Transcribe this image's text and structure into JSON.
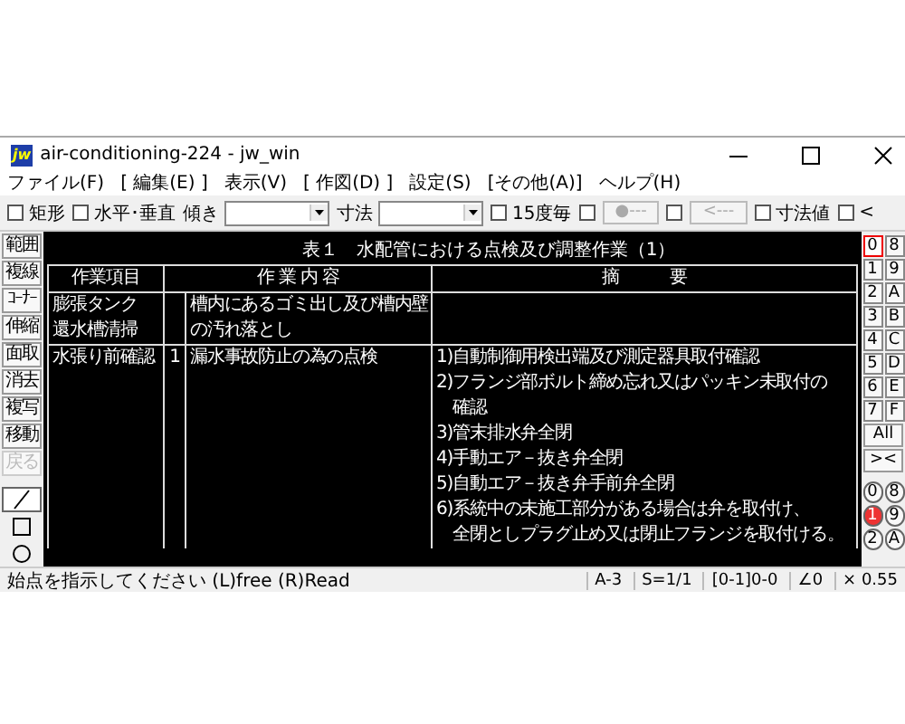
{
  "window": {
    "title": "air-conditioning-224 - jw_win",
    "app_icon_label": "jw"
  },
  "menu": [
    "ファイル(F)",
    "[ 編集(E) ]",
    "表示(V)",
    "[ 作図(D) ]",
    "設定(S)",
    "[その他(A)]",
    "ヘルプ(H)"
  ],
  "toolbar": [
    {
      "kind": "checkbox",
      "label": "矩形",
      "checked": false
    },
    {
      "kind": "checkbox",
      "label": "水平･垂直",
      "checked": false
    },
    {
      "kind": "dropdown",
      "label": "傾き"
    },
    {
      "kind": "dropdown",
      "label": "寸法"
    },
    {
      "kind": "checkbox",
      "label": "15度毎",
      "checked": false
    },
    {
      "kind": "checkbox",
      "checked": false
    },
    {
      "kind": "button",
      "label": "●---",
      "disabled": true
    },
    {
      "kind": "checkbox",
      "checked": false
    },
    {
      "kind": "button",
      "label": "<---",
      "disabled": true
    },
    {
      "kind": "checkbox",
      "label": "寸法値",
      "checked": false
    },
    {
      "kind": "checkbox",
      "label": "<",
      "checked": false
    }
  ],
  "left_tools": [
    {
      "label": "範囲",
      "disabled": false
    },
    {
      "label": "複線",
      "disabled": false
    },
    {
      "label": "ｺｰﾅｰ",
      "disabled": false
    },
    {
      "label": "伸縮",
      "disabled": false
    },
    {
      "label": "面取",
      "disabled": false
    },
    {
      "label": "消去",
      "disabled": false
    },
    {
      "label": "複写",
      "disabled": false
    },
    {
      "label": "移動",
      "disabled": false
    },
    {
      "label": "戻る",
      "disabled": true
    }
  ],
  "draw_tools": [
    {
      "kind": "line",
      "selected": true
    },
    {
      "kind": "rect",
      "selected": false
    },
    {
      "kind": "circle",
      "selected": false
    }
  ],
  "table": {
    "title": "表１　水配管における点検及び調整作業（1）",
    "columns": [
      "作業項目",
      "作 業 内 容",
      "摘　　　要"
    ],
    "rows": [
      {
        "item": [
          "膨張タンク",
          "還水槽清掃"
        ],
        "no": "",
        "content": [
          "槽内にあるゴミ出し及び槽内壁",
          "の汚れ落とし"
        ],
        "notes": []
      },
      {
        "item": [
          "水張り前確認"
        ],
        "no": "1",
        "content": [
          "漏水事故防止の為の点検"
        ],
        "notes": [
          [
            "1)自動制御用検出端及び測定器具取付確認"
          ],
          [
            "2)フランジ部ボルト締め忘れ又はパッキン未取付の",
            "確認"
          ],
          [
            "3)管末排水弁全閉"
          ],
          [
            "4)手動エア－抜き弁全閉"
          ],
          [
            "5)自動エア－抜き弁手前弁全閉"
          ],
          [
            "6)系統中の未施工部分がある場合は弁を取付け、",
            "全閉としプラグ止め又は閉止フランジを取付ける。"
          ]
        ]
      }
    ]
  },
  "layers": [
    {
      "label": "0",
      "selected": true
    },
    {
      "label": "8",
      "selected": false
    },
    {
      "label": "1",
      "selected": false
    },
    {
      "label": "9",
      "selected": false
    },
    {
      "label": "2",
      "selected": false
    },
    {
      "label": "A",
      "selected": false
    },
    {
      "label": "3",
      "selected": false
    },
    {
      "label": "B",
      "selected": false
    },
    {
      "label": "4",
      "selected": false
    },
    {
      "label": "C",
      "selected": false
    },
    {
      "label": "5",
      "selected": false
    },
    {
      "label": "D",
      "selected": false
    },
    {
      "label": "6",
      "selected": false
    },
    {
      "label": "E",
      "selected": false
    },
    {
      "label": "7",
      "selected": false
    },
    {
      "label": "F",
      "selected": false
    }
  ],
  "layer_actions": [
    "All",
    "><"
  ],
  "groups": [
    {
      "label": "0",
      "selected": false
    },
    {
      "label": "8",
      "selected": false
    },
    {
      "label": "1",
      "selected": true
    },
    {
      "label": "9",
      "selected": false
    },
    {
      "label": "2",
      "selected": false
    },
    {
      "label": "A",
      "selected": false
    }
  ],
  "status_bar": {
    "message": "始点を指示してください (L)free (R)Read",
    "fields": [
      "A-3",
      "S=1/1",
      "[0-1]0-0",
      "∠0",
      "× 0.55"
    ]
  }
}
